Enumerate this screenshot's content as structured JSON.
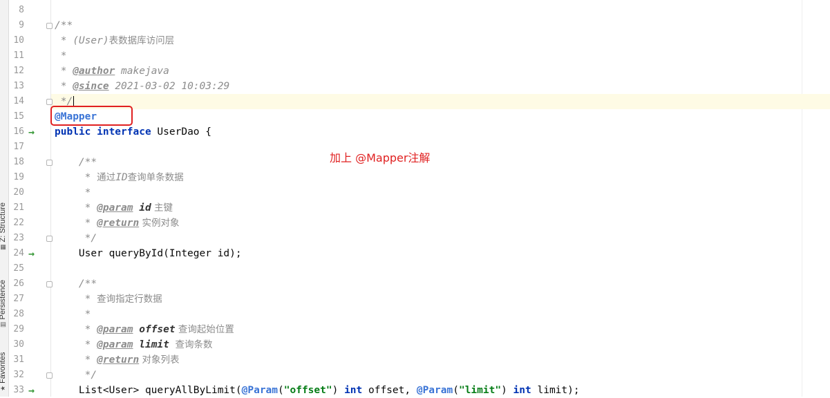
{
  "sidebar": {
    "structure_label": "Z: Structure",
    "persistence_label": "Persistence",
    "favorites_label": "Favorites"
  },
  "editor": {
    "lines": [
      {
        "n": "8"
      },
      {
        "n": "9",
        "c1": "/**"
      },
      {
        "n": "10",
        "c1": " * (User)",
        "c2": "表数据库访问层"
      },
      {
        "n": "11",
        "c1": " *"
      },
      {
        "n": "12",
        "c1": " * ",
        "c2": "@author",
        "c3": " makejava"
      },
      {
        "n": "13",
        "c1": " * ",
        "c2": "@since",
        "c3": " 2021-03-02 10:03:29"
      },
      {
        "n": "14",
        "c1": " */"
      },
      {
        "n": "15",
        "c1": "@Mapper"
      },
      {
        "n": "16",
        "c1": "public interface",
        "c2": " UserDao {"
      },
      {
        "n": "17"
      },
      {
        "n": "18",
        "c1": "    /**"
      },
      {
        "n": "19",
        "c1": "     * ",
        "c2": "通过",
        "c3": "ID",
        "c4": "查询单条数据"
      },
      {
        "n": "20",
        "c1": "     *"
      },
      {
        "n": "21",
        "c1": "     * ",
        "c2": "@param",
        "c3": " id",
        "c4": " 主键"
      },
      {
        "n": "22",
        "c1": "     * ",
        "c2": "@return",
        "c3": " 实例对象"
      },
      {
        "n": "23",
        "c1": "     */"
      },
      {
        "n": "24",
        "c1": "    User queryById(Integer id);"
      },
      {
        "n": "25"
      },
      {
        "n": "26",
        "c1": "    /**"
      },
      {
        "n": "27",
        "c1": "     * ",
        "c2": "查询指定行数据"
      },
      {
        "n": "28",
        "c1": "     *"
      },
      {
        "n": "29",
        "c1": "     * ",
        "c2": "@param",
        "c3": " offset",
        "c4": " 查询起始位置"
      },
      {
        "n": "30",
        "c1": "     * ",
        "c2": "@param",
        "c3": " limit",
        "c4": "  查询条数"
      },
      {
        "n": "31",
        "c1": "     * ",
        "c2": "@return",
        "c3": " 对象列表"
      },
      {
        "n": "32",
        "c1": "     */"
      },
      {
        "n": "33",
        "c1": "    List<User> queryAllByLimit(",
        "c2": "@Param",
        "c3": "(",
        "c4": "\"offset\"",
        "c5": ") ",
        "c6": "int",
        "c7": " offset, ",
        "c8": "@Param",
        "c9": "(",
        "c10": "\"limit\"",
        "c11": ") ",
        "c12": "int",
        "c13": " limit);"
      }
    ]
  },
  "annotation_note": "加上 @Mapper注解",
  "colors": {
    "highlight_box": "#e02020",
    "current_line": "#fefbe5",
    "keyword": "#0033b3",
    "annotation": "#3a74d6",
    "string": "#067d17",
    "comment": "#8c8c8c",
    "gutter_arrow": "#3a9a3a"
  }
}
